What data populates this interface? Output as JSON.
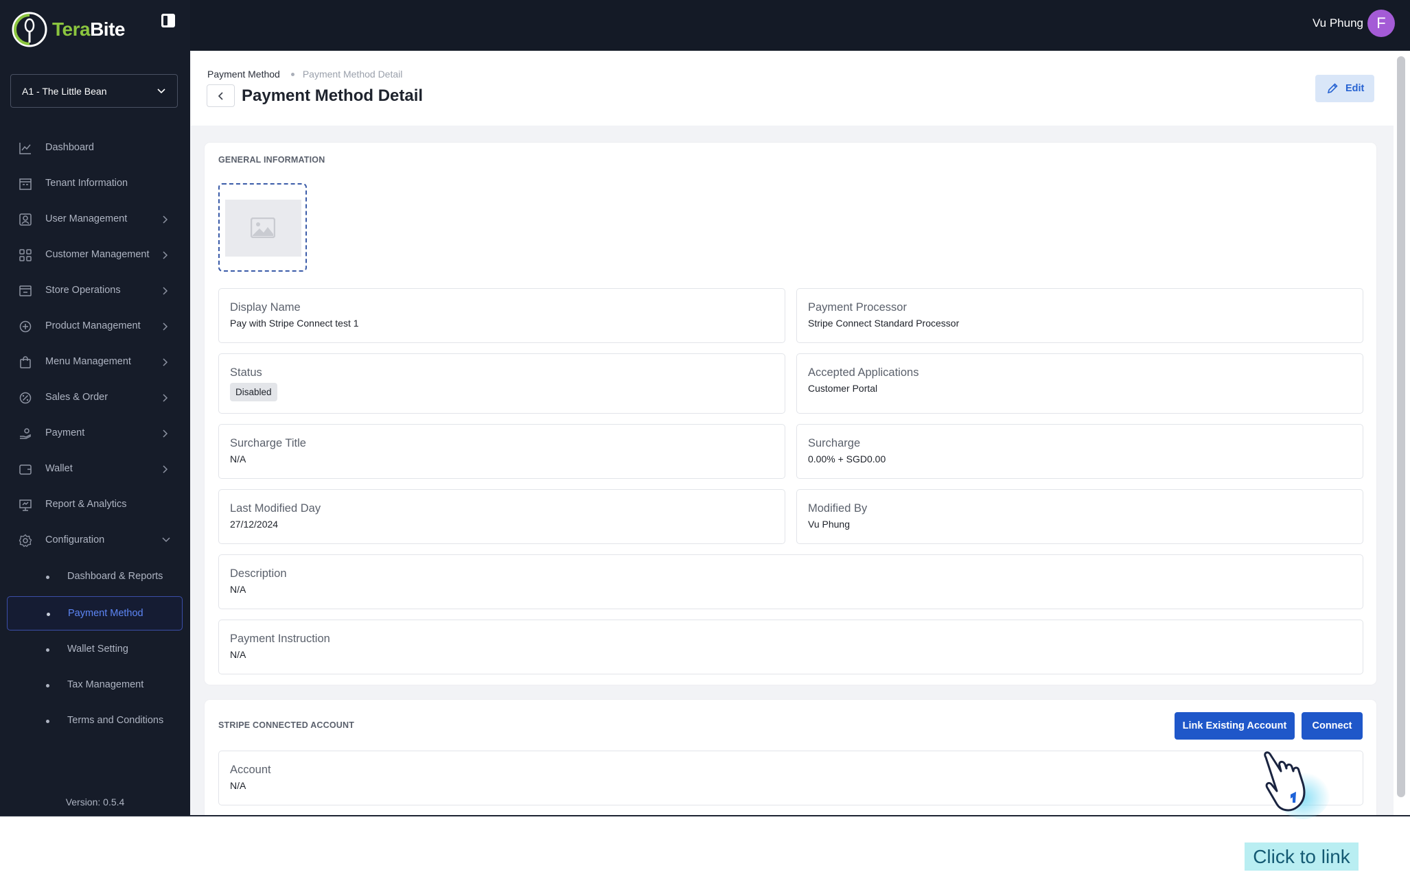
{
  "app": {
    "brand_part1": "Tera",
    "brand_part2": "Bite",
    "version": "Version: 0.5.4"
  },
  "tenant": {
    "selected": "A1 - The Little Bean"
  },
  "user": {
    "name": "Vu Phung",
    "initial": "F"
  },
  "sidebar": {
    "items": [
      {
        "label": "Dashboard",
        "icon": "chart-line-icon",
        "chevron": false
      },
      {
        "label": "Tenant Information",
        "icon": "building-icon",
        "chevron": false
      },
      {
        "label": "User Management",
        "icon": "user-square-icon",
        "chevron": true
      },
      {
        "label": "Customer Management",
        "icon": "grid-icon",
        "chevron": true
      },
      {
        "label": "Store Operations",
        "icon": "store-icon",
        "chevron": true
      },
      {
        "label": "Product Management",
        "icon": "product-icon",
        "chevron": true
      },
      {
        "label": "Menu Management",
        "icon": "bag-icon",
        "chevron": true
      },
      {
        "label": "Sales & Order",
        "icon": "percent-icon",
        "chevron": true
      },
      {
        "label": "Payment",
        "icon": "hand-coin-icon",
        "chevron": true
      },
      {
        "label": "Wallet",
        "icon": "wallet-icon",
        "chevron": true
      },
      {
        "label": "Report & Analytics",
        "icon": "presentation-icon",
        "chevron": false
      },
      {
        "label": "Configuration",
        "icon": "gear-icon",
        "chevron": "down"
      }
    ],
    "config_sub": [
      {
        "label": "Dashboard & Reports",
        "active": false
      },
      {
        "label": "Payment Method",
        "active": true
      },
      {
        "label": "Wallet Setting",
        "active": false
      },
      {
        "label": "Tax Management",
        "active": false
      },
      {
        "label": "Terms and Conditions",
        "active": false
      }
    ]
  },
  "breadcrumb": {
    "parent": "Payment Method",
    "current": "Payment Method Detail"
  },
  "page": {
    "title": "Payment Method Detail",
    "edit_label": "Edit"
  },
  "general": {
    "section_title": "GENERAL INFORMATION",
    "display_name": {
      "label": "Display Name",
      "value": "Pay with Stripe Connect test 1"
    },
    "payment_processor": {
      "label": "Payment Processor",
      "value": "Stripe Connect Standard Processor"
    },
    "status": {
      "label": "Status",
      "value": "Disabled"
    },
    "accepted_applications": {
      "label": "Accepted Applications",
      "value": "Customer Portal"
    },
    "surcharge_title": {
      "label": "Surcharge Title",
      "value": "N/A"
    },
    "surcharge": {
      "label": "Surcharge",
      "value": "0.00% + SGD0.00"
    },
    "last_modified": {
      "label": "Last Modified Day",
      "value": "27/12/2024"
    },
    "modified_by": {
      "label": "Modified By",
      "value": "Vu Phung"
    },
    "description": {
      "label": "Description",
      "value": "N/A"
    },
    "payment_instruction": {
      "label": "Payment Instruction",
      "value": "N/A"
    }
  },
  "stripe": {
    "section_title": "STRIPE CONNECTED ACCOUNT",
    "link_label": "Link Existing Account",
    "connect_label": "Connect",
    "account": {
      "label": "Account",
      "value": "N/A"
    }
  },
  "overlay": {
    "click_note": "Click to link"
  },
  "colors": {
    "sidebar_bg": "#161c29",
    "accent": "#1f57c9",
    "brand_green": "#8bc53f",
    "active_text": "#5d86f5"
  }
}
